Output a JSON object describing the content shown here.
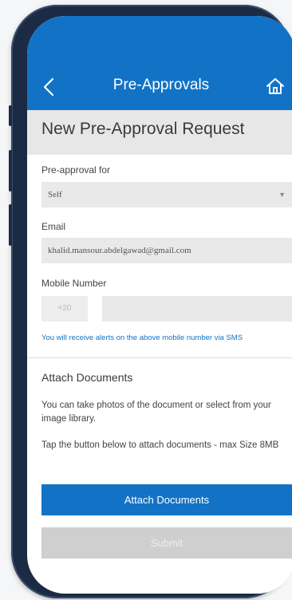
{
  "nav": {
    "title": "Pre-Approvals"
  },
  "page": {
    "title": "New Pre-Approval Request"
  },
  "form": {
    "preapproval_label": "Pre-approval for",
    "preapproval_value": "Self",
    "email_label": "Email",
    "email_value": "khalid.mansour.abdelgawad@gmail.com",
    "mobile_label": "Mobile Number",
    "country_code": "+20",
    "mobile_value": "",
    "sms_note": "You will receive alerts on the above mobile number via SMS"
  },
  "attach": {
    "title": "Attach Documents",
    "description": "You can take photos of the document or select from your image library.",
    "instruction": "Tap the button below to attach documents - max Size 8MB",
    "button_label": "Attach Documents"
  },
  "submit_label": "Submit",
  "colors": {
    "primary": "#1273c6",
    "header_gray": "#e7e7e7",
    "field_gray": "#e9e9e9",
    "disabled": "#cfcfcf"
  },
  "icons": {
    "back": "chevron-left-icon",
    "home": "home-icon",
    "dropdown": "caret-down-icon"
  }
}
